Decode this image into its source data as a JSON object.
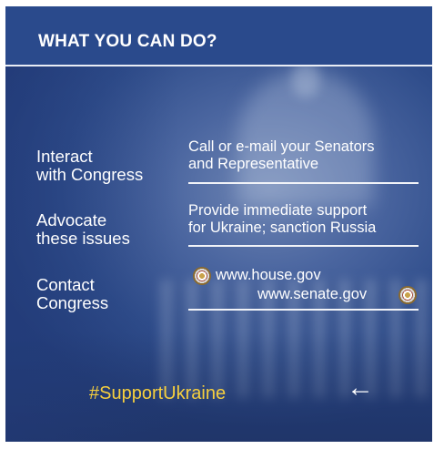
{
  "header": {
    "title": "WHAT YOU CAN DO?"
  },
  "items": [
    {
      "label_lines": [
        "Interact",
        "with Congress"
      ],
      "desc_lines": [
        "Call or e-mail your Senators",
        "and Representative"
      ]
    },
    {
      "label_lines": [
        "Advocate",
        "these issues"
      ],
      "desc_lines": [
        "Provide immediate support",
        "for Ukraine; sanction Russia"
      ]
    },
    {
      "label_lines": [
        "Contact",
        "Congress"
      ],
      "websites": [
        "www.house.gov",
        "www.senate.gov"
      ]
    }
  ],
  "footer": {
    "hashtag": "#SupportUkraine",
    "arrow_icon": "arrow-left-icon"
  },
  "colors": {
    "header_bg": "#2a4a8c",
    "hashtag": "#f6cf3e"
  }
}
